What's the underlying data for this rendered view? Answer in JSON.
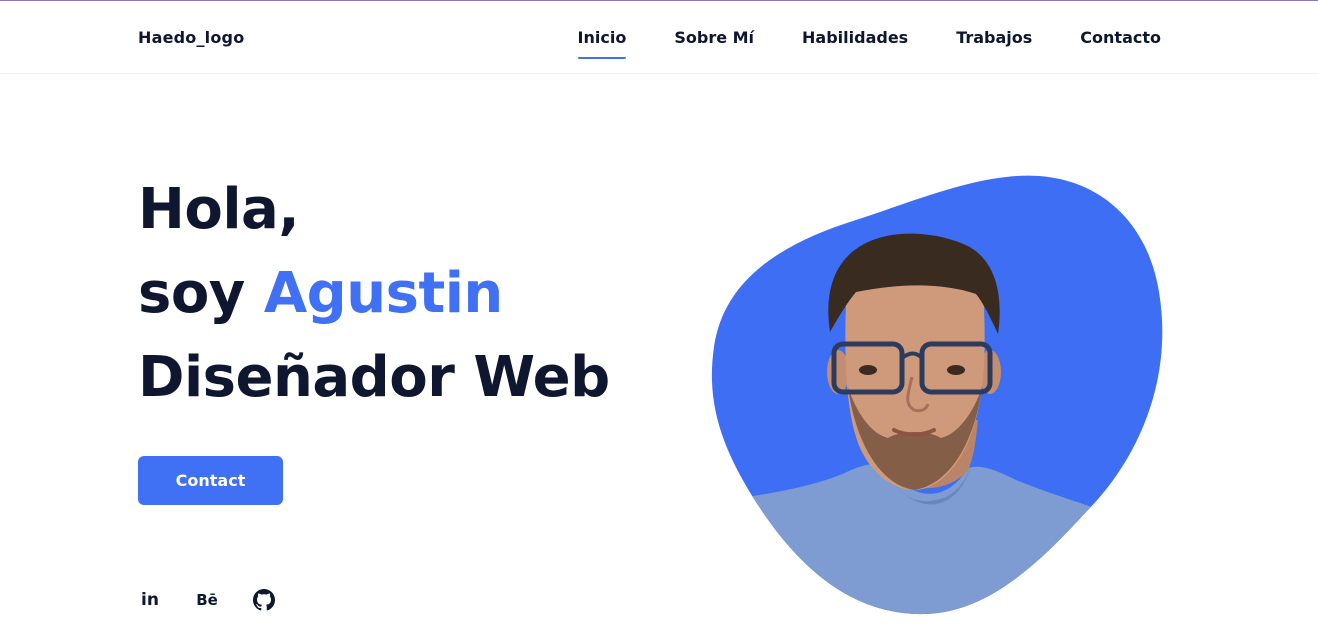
{
  "header": {
    "logo": "Haedo_logo",
    "nav": [
      {
        "label": "Inicio",
        "active": true
      },
      {
        "label": "Sobre Mí",
        "active": false
      },
      {
        "label": "Habilidades",
        "active": false
      },
      {
        "label": "Trabajos",
        "active": false
      },
      {
        "label": "Contacto",
        "active": false
      }
    ]
  },
  "hero": {
    "line1": "Hola,",
    "line2_prefix": "soy",
    "name": "Agustin",
    "line3": "Diseñador Web",
    "contact_button": "Contact"
  },
  "socials": {
    "linkedin": {
      "text": "in",
      "icon": "linkedin-icon"
    },
    "behance": {
      "text": "Bē",
      "icon": "behance-icon"
    },
    "github": {
      "icon": "github-icon"
    }
  },
  "colors": {
    "accent": "#4070f4",
    "text": "#0e1630",
    "blob": "#3d6ef3",
    "shirt": "#7e9bd2"
  }
}
